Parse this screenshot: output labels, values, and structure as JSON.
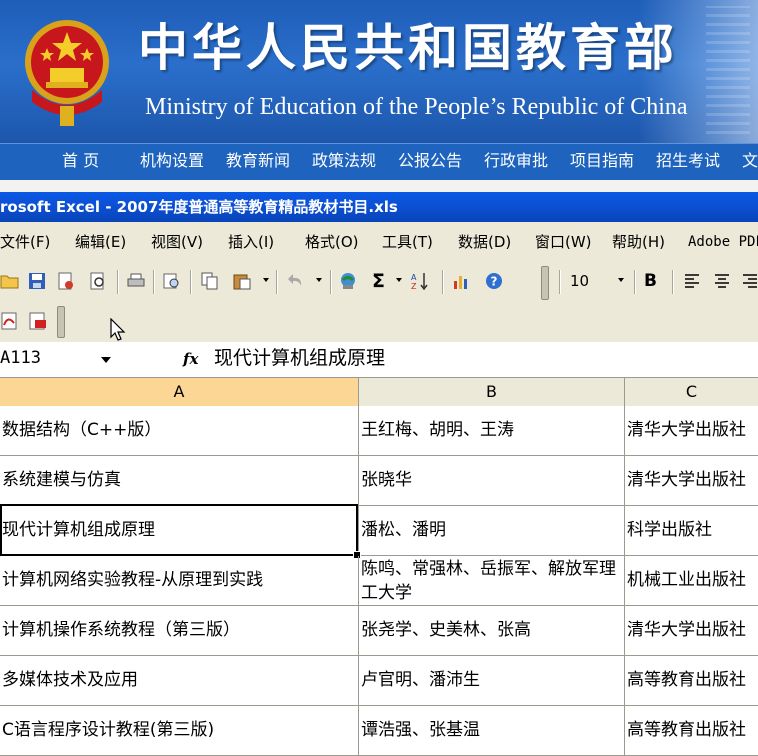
{
  "banner": {
    "title_cn": "中华人民共和国教育部",
    "title_en": "Ministry of Education of the People’s Republic of China",
    "emblem_icon": "national-emblem-icon"
  },
  "site_nav": {
    "items": [
      "首 页",
      "机构设置",
      "教育新闻",
      "政策法规",
      "公报公告",
      "行政审批",
      "项目指南",
      "招生考试",
      "文"
    ]
  },
  "excel": {
    "title": "rosoft Excel - 2007年度普通高等教育精品教材书目.xls",
    "menu": [
      "文件(F)",
      "编辑(E)",
      "视图(V)",
      "插入(I)",
      "格式(O)",
      "工具(T)",
      "数据(D)",
      "窗口(W)",
      "帮助(H)",
      "Adobe PDF"
    ],
    "toolbar": {
      "font_size": "10",
      "bold_label": "B",
      "icons": [
        "open-icon",
        "save-icon",
        "permission-icon",
        "print-preview-icon",
        "print-icon",
        "research-icon",
        "copy-icon",
        "paste-icon",
        "undo-icon",
        "hyperlink-icon",
        "autosum-icon",
        "sort-ascending-icon",
        "chart-wizard-icon",
        "help-icon",
        "align-left-icon",
        "align-center-icon",
        "align-right-icon",
        "pdf-convert-icon",
        "pdf-email-icon"
      ]
    },
    "formula_bar": {
      "name_box": "A113",
      "fx_label": "fx",
      "value": "现代计算机组成原理"
    },
    "columns": [
      "A",
      "B",
      "C"
    ],
    "rows": [
      {
        "a": "数据结构（C++版）",
        "b": "王红梅、胡明、王涛",
        "c": "清华大学出版社"
      },
      {
        "a": "系统建模与仿真",
        "b": "张晓华",
        "c": "清华大学出版社"
      },
      {
        "a": "现代计算机组成原理",
        "b": "潘松、潘明",
        "c": "科学出版社"
      },
      {
        "a": "计算机网络实验教程-从原理到实践",
        "b": "陈鸣、常强林、岳振军、解放军理工大学",
        "c": "机械工业出版社"
      },
      {
        "a": "计算机操作系统教程（第三版）",
        "b": "张尧学、史美林、张高",
        "c": "清华大学出版社"
      },
      {
        "a": "多媒体技术及应用",
        "b": "卢官明、潘沛生",
        "c": "高等教育出版社"
      },
      {
        "a": "C语言程序设计教程(第三版)",
        "b": "谭浩强、张基温",
        "c": "高等教育出版社"
      }
    ],
    "selected_row_index": 2
  },
  "colors": {
    "banner_blue": "#1e5db8",
    "excel_title_blue": "#0a59e5",
    "toolbar_bg": "#ece9d8",
    "selected_header": "#fcd694"
  }
}
